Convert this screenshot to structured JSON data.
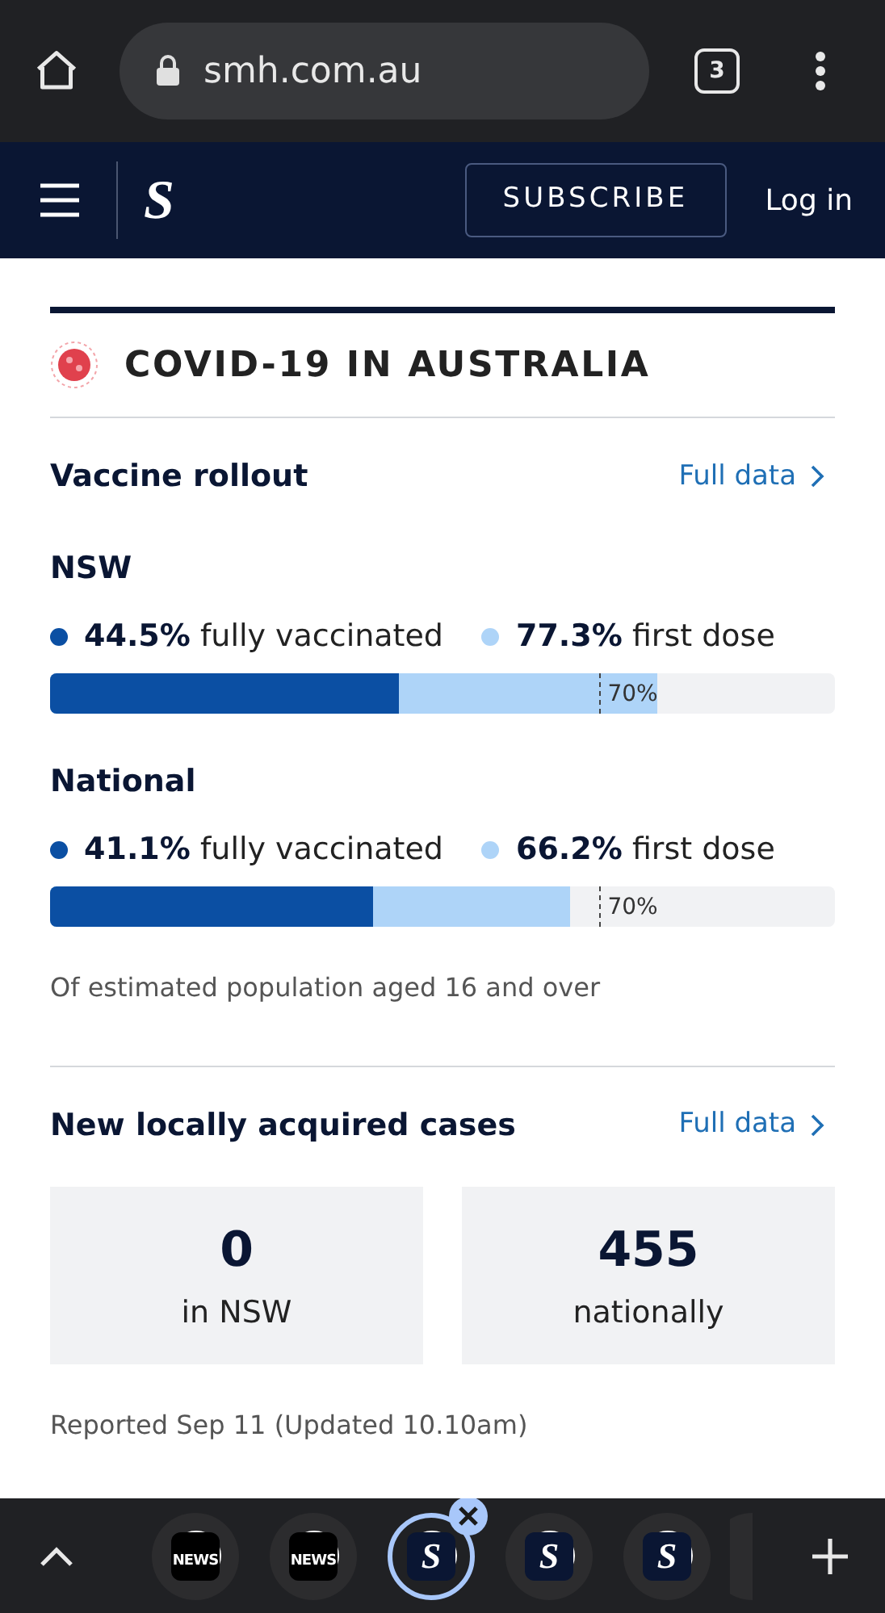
{
  "browser": {
    "url": "smh.com.au",
    "tab_count": "3"
  },
  "nav": {
    "logo": "S",
    "subscribe": "SUBSCRIBE",
    "login": "Log in"
  },
  "section": {
    "title": "COVID-19 IN AUSTRALIA"
  },
  "vaccine": {
    "heading": "Vaccine rollout",
    "link": "Full data",
    "regions": [
      {
        "name": "NSW",
        "full": {
          "value": "44.5%",
          "label": "fully vaccinated",
          "level": 0.445
        },
        "first": {
          "value": "77.3%",
          "label": "first dose",
          "level": 0.773
        },
        "target": "70%"
      },
      {
        "name": "National",
        "full": {
          "value": "41.1%",
          "label": "fully vaccinated",
          "level": 0.411
        },
        "first": {
          "value": "66.2%",
          "label": "first dose",
          "level": 0.662
        },
        "target": "70%"
      }
    ],
    "note": "Of estimated population aged 16 and over"
  },
  "cases": {
    "heading": "New locally acquired cases",
    "link": "Full data",
    "cards": [
      {
        "value": "0",
        "label": "in NSW"
      },
      {
        "value": "455",
        "label": "nationally"
      }
    ],
    "reported": "Reported Sep 11 (Updated 10.10am)"
  },
  "tab_strip": {
    "tabs": [
      {
        "kind": "news",
        "label": "NEWS",
        "selected": false
      },
      {
        "kind": "news",
        "label": "NEWS",
        "selected": false
      },
      {
        "kind": "smh",
        "label": "S",
        "selected": true
      },
      {
        "kind": "smh",
        "label": "S",
        "selected": false
      },
      {
        "kind": "smh",
        "label": "S",
        "selected": false
      }
    ]
  }
}
